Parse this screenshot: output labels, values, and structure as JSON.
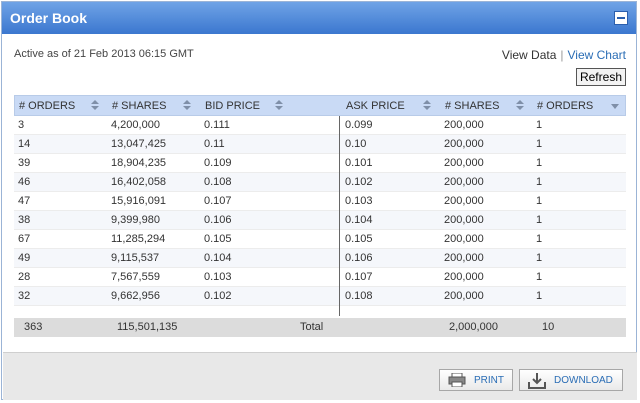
{
  "window": {
    "title": "Order Book"
  },
  "status": {
    "active_text": "Active as of 21 Feb 2013 06:15 GMT"
  },
  "links": {
    "view_data": "View Data",
    "separator": "|",
    "view_chart": "View Chart"
  },
  "actions": {
    "refresh": "Refresh",
    "print": "PRINT",
    "download": "DOWNLOAD"
  },
  "table": {
    "headers": [
      "# ORDERS",
      "# SHARES",
      "BID PRICE",
      "ASK PRICE",
      "# SHARES",
      "# ORDERS"
    ],
    "rows": [
      [
        "3",
        "4,200,000",
        "0.111",
        "0.099",
        "200,000",
        "1"
      ],
      [
        "14",
        "13,047,425",
        "0.11",
        "0.10",
        "200,000",
        "1"
      ],
      [
        "39",
        "18,904,235",
        "0.109",
        "0.101",
        "200,000",
        "1"
      ],
      [
        "46",
        "16,402,058",
        "0.108",
        "0.102",
        "200,000",
        "1"
      ],
      [
        "47",
        "15,916,091",
        "0.107",
        "0.103",
        "200,000",
        "1"
      ],
      [
        "38",
        "9,399,980",
        "0.106",
        "0.104",
        "200,000",
        "1"
      ],
      [
        "67",
        "11,285,294",
        "0.105",
        "0.105",
        "200,000",
        "1"
      ],
      [
        "49",
        "9,115,537",
        "0.104",
        "0.106",
        "200,000",
        "1"
      ],
      [
        "28",
        "7,567,559",
        "0.103",
        "0.107",
        "200,000",
        "1"
      ],
      [
        "32",
        "9,662,956",
        "0.102",
        "0.108",
        "200,000",
        "1"
      ]
    ],
    "totals": {
      "orders_bid": "363",
      "shares_bid": "115,501,135",
      "label": "Total",
      "shares_ask": "2,000,000",
      "orders_ask": "10"
    }
  },
  "colors": {
    "titlebar": "#3b77cf",
    "header_bg": "#c9daf5",
    "link": "#2a6db5"
  },
  "icons": {
    "minimize": "minimize-icon",
    "print": "printer-icon",
    "download": "download-icon"
  }
}
